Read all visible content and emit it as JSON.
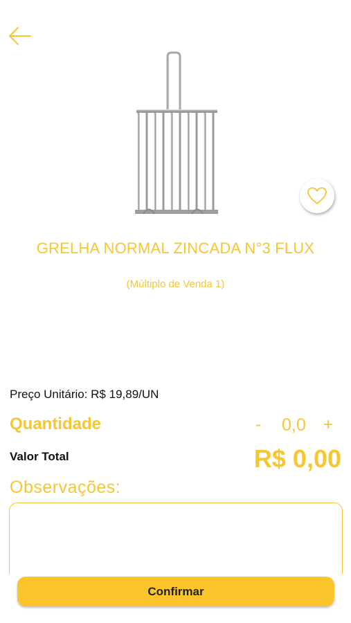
{
  "header": {
    "back_icon": "arrow-left-icon"
  },
  "product": {
    "image_icon": "grill-basket-image",
    "favorite_icon": "heart-outline-icon",
    "name": "GRELHA NORMAL ZINCADA N°3 FLUX",
    "sale_multiple": "(Múltiplo de Venda 1)"
  },
  "pricing": {
    "unit_price": "Preço Unitário: R$ 19,89/UN",
    "quantity_label": "Quantidade",
    "quantity_minus": "-",
    "quantity_value": "0,0",
    "quantity_plus": "+",
    "total_label": "Valor Total",
    "total_value": "R$ 0,00"
  },
  "notes": {
    "label": "Observações:",
    "value": ""
  },
  "actions": {
    "confirm_label": "Confirmar"
  },
  "colors": {
    "accent": "#f6c633",
    "button": "#fbc52b",
    "text": "#111111"
  }
}
